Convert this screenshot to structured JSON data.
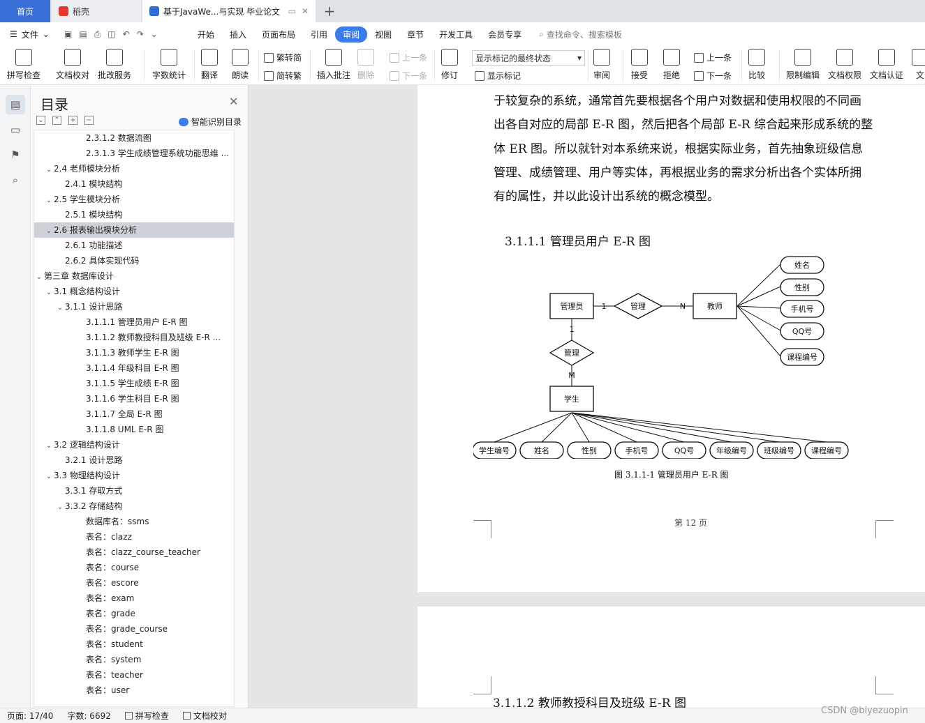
{
  "tabs": [
    {
      "label": "首页"
    },
    {
      "label": "稻壳"
    },
    {
      "label": "基于JavaWe...与实现 毕业论文"
    }
  ],
  "menubar": {
    "file_label": "文件",
    "items": [
      "开始",
      "插入",
      "页面布局",
      "引用",
      "审阅",
      "视图",
      "章节",
      "开发工具",
      "会员专享"
    ],
    "active": "审阅",
    "search_placeholder": "查找命令、搜索模板"
  },
  "ribbon": {
    "spell_check": "拼写检查",
    "doc_proof": "文档校对",
    "annotate_service": "批改服务",
    "word_count": "字数统计",
    "translate": "翻译",
    "read_aloud": "朗读",
    "trad_convert": "繁转简",
    "simp_convert": "简转繁",
    "insert_comment": "插入批注",
    "delete": "删除",
    "prev_comment": "上一条",
    "next_comment": "下一条",
    "revise": "修订",
    "markup_state": "显示标记的最终状态",
    "show_markup": "显示标记",
    "review": "审阅",
    "accept": "接受",
    "reject": "拒绝",
    "prev_change": "上一条",
    "next_change": "下一条",
    "compare": "比较",
    "restrict_edit": "限制编辑",
    "doc_permission": "文档权限",
    "doc_cert": "文档认证",
    "doc_more": "文"
  },
  "toc": {
    "title": "目录",
    "smart_label": "智能识别目录",
    "items": [
      {
        "text": "2.3.1.2  数据流图",
        "level": 4,
        "caret": ""
      },
      {
        "text": "2.3.1.3  学生成绩管理系统功能思维 ...",
        "level": 4,
        "caret": ""
      },
      {
        "text": "2.4 老师模块分析",
        "level": 2,
        "caret": "v"
      },
      {
        "text": "2.4.1 模块结构",
        "level": 3,
        "caret": ""
      },
      {
        "text": "2.5 学生模块分析",
        "level": 2,
        "caret": "v"
      },
      {
        "text": "2.5.1 模块结构",
        "level": 3,
        "caret": ""
      },
      {
        "text": "2.6 报表输出模块分析",
        "level": 2,
        "caret": "v",
        "selected": true
      },
      {
        "text": "2.6.1 功能描述",
        "level": 3,
        "caret": ""
      },
      {
        "text": "2.6.2 具体实现代码",
        "level": 3,
        "caret": ""
      },
      {
        "text": "第三章  数据库设计",
        "level": 1,
        "caret": "v"
      },
      {
        "text": "3.1 概念结构设计",
        "level": 2,
        "caret": "v"
      },
      {
        "text": "3.1.1 设计思路",
        "level": 3,
        "caret": "v"
      },
      {
        "text": "3.1.1.1  管理员用户 E-R 图",
        "level": 4,
        "caret": ""
      },
      {
        "text": "3.1.1.2  教师教授科目及班级 E-R ...",
        "level": 4,
        "caret": ""
      },
      {
        "text": "3.1.1.3  教师学生 E-R 图",
        "level": 4,
        "caret": ""
      },
      {
        "text": "3.1.1.4  年级科目 E-R 图",
        "level": 4,
        "caret": ""
      },
      {
        "text": "3.1.1.5  学生成绩 E-R 图",
        "level": 4,
        "caret": ""
      },
      {
        "text": "3.1.1.6  学生科目 E-R 图",
        "level": 4,
        "caret": ""
      },
      {
        "text": "3.1.1.7  全局 E-R 图",
        "level": 4,
        "caret": ""
      },
      {
        "text": "3.1.1.8 UML E-R 图",
        "level": 4,
        "caret": ""
      },
      {
        "text": "3.2 逻辑结构设计",
        "level": 2,
        "caret": "v"
      },
      {
        "text": "3.2.1 设计思路",
        "level": 3,
        "caret": ""
      },
      {
        "text": "3.3 物理结构设计",
        "level": 2,
        "caret": "v"
      },
      {
        "text": "3.3.1 存取方式",
        "level": 3,
        "caret": ""
      },
      {
        "text": "3.3.2 存储结构",
        "level": 3,
        "caret": "v"
      },
      {
        "text": "数据库名：ssms",
        "level": 4,
        "caret": ""
      },
      {
        "text": "表名：clazz",
        "level": 4,
        "caret": ""
      },
      {
        "text": "表名：clazz_course_teacher",
        "level": 4,
        "caret": ""
      },
      {
        "text": "表名：course",
        "level": 4,
        "caret": ""
      },
      {
        "text": "表名：escore",
        "level": 4,
        "caret": ""
      },
      {
        "text": "表名：exam",
        "level": 4,
        "caret": ""
      },
      {
        "text": "表名：grade",
        "level": 4,
        "caret": ""
      },
      {
        "text": "表名：grade_course",
        "level": 4,
        "caret": ""
      },
      {
        "text": "表名：student",
        "level": 4,
        "caret": ""
      },
      {
        "text": "表名：system",
        "level": 4,
        "caret": ""
      },
      {
        "text": "表名：teacher",
        "level": 4,
        "caret": ""
      },
      {
        "text": "表名：user",
        "level": 4,
        "caret": ""
      }
    ]
  },
  "doc": {
    "lines": [
      "于较复杂的系统，通常首先要根据各个用户对数据和使用权限的不同画",
      "出各自对应的局部 E-R 图，然后把各个局部 E-R 综合起来形成系统的整",
      "体 ER 图。所以就针对本系统来说，根据实际业务，首先抽象班级信息",
      "管理、成绩管理、用户等实体，再根据业务的需求分析出各个实体所拥",
      "有的属性，并以此设计出系统的概念模型。"
    ],
    "heading": "3.1.1.1  管理员用户 E-R 图",
    "er": {
      "admin": "管理员",
      "manage1": "管理",
      "teacher": "教师",
      "manage2": "管理",
      "student": "学生",
      "card_1a": "1",
      "card_n": "N",
      "card_1b": "1",
      "card_m": "M",
      "teacher_attrs": [
        "姓名",
        "性别",
        "手机号",
        "QQ号",
        "课程编号"
      ],
      "student_attrs": [
        "学生编号",
        "姓名",
        "性别",
        "手机号",
        "QQ号",
        "年级编号",
        "班级编号",
        "课程编号"
      ]
    },
    "caption": "图 3.1.1-1 管理员用户 E-R 图",
    "page_number": "第  12  页",
    "next_heading": "3.1.1.2  教师教授科目及班级 E-R 图"
  },
  "status": {
    "page": "页面: 17/40",
    "words": "字数: 6692",
    "spell": "拼写检查",
    "proof": "文档校对"
  },
  "watermark": "CSDN @biyezuopin"
}
